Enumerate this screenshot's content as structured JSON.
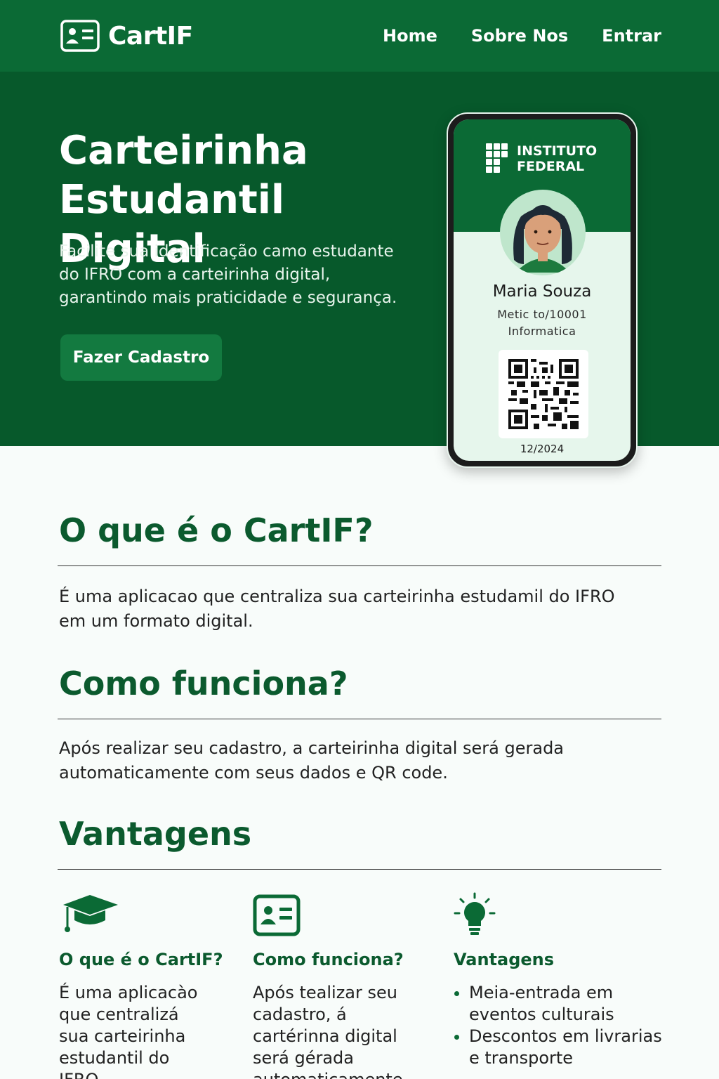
{
  "header": {
    "brand": "CartIF",
    "nav": [
      "Home",
      "Sobre Nos",
      "Entrar"
    ]
  },
  "hero": {
    "title": "Carteirinha Estudantil Digital",
    "subtitle": "Facilite sua identificação camo estudante do IFRO com a carteirinha digital, garantindo mais praticidade e segurança.",
    "cta_label": "Fazer Cadastro"
  },
  "card": {
    "institution": "INSTITUTO FEDERAL",
    "name": "Maria Souza",
    "id": "Metic to/10001",
    "course": "Informatica",
    "date": "12/2024"
  },
  "sections": {
    "what_title": "O que é o CartIF?",
    "what_text": "É uma aplicacao que centraliza sua carteirinha estudamil do IFRO em um formato digital.",
    "how_title": "Como funciona?",
    "how_text": "Após realizar seu cadastro, a carteirinha digital será gerada automaticamente com seus dados e QR code.",
    "adv_title": "Vantagens"
  },
  "features": {
    "col1_title": "O que é o CartIF?",
    "col1_text": "É uma aplicacào que centralizá sua carteirinha estudantil do IFRO",
    "col2_title": "Como funciona?",
    "col2_text": "Após tealizar seu cadastro, á cartérinna digital será gérada automaticamente com",
    "col3_title": "Vantagens",
    "col3_items": [
      "Meia-entrada em eventos culturais",
      "Descontos em livrarias e transporte"
    ]
  },
  "icons": {
    "brand": "id-card-icon",
    "col1": "graduation-cap-icon",
    "col2": "id-card-icon",
    "col3": "lightbulb-icon"
  },
  "colors": {
    "header": "#0b6a35",
    "hero": "#07592b",
    "accent": "#0b5a2e"
  }
}
